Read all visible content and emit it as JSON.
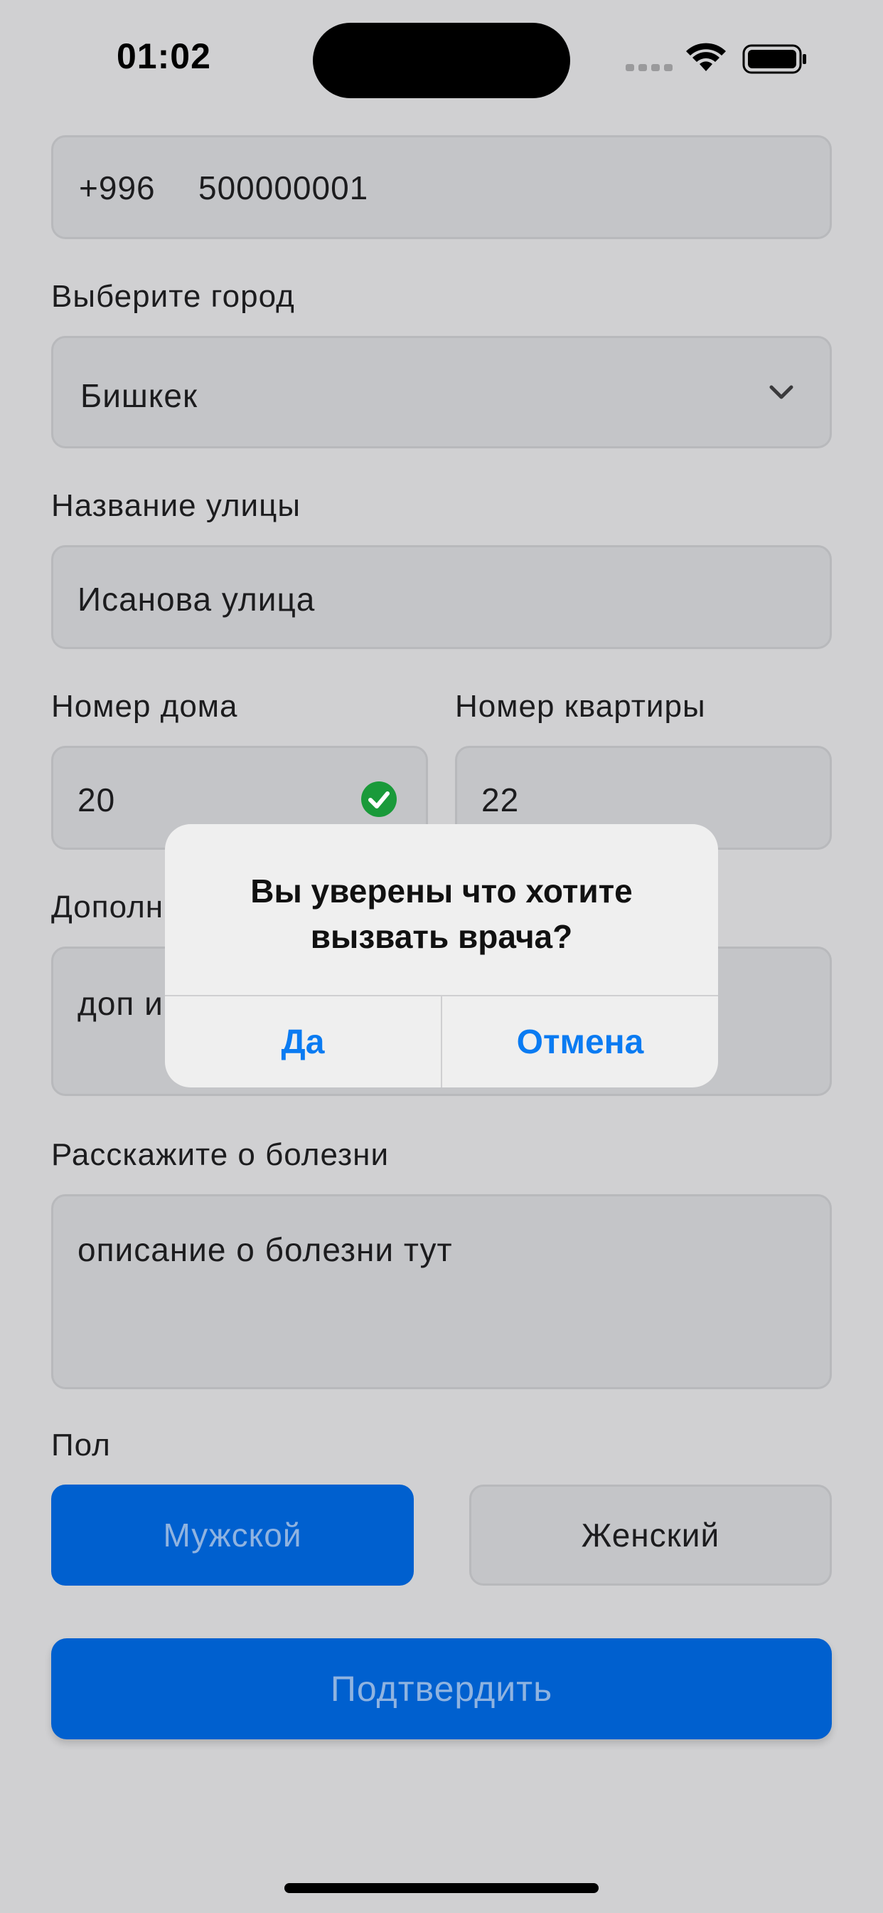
{
  "status_bar": {
    "time": "01:02"
  },
  "form": {
    "phone": {
      "code": "+996",
      "number": "500000001"
    },
    "city": {
      "label": "Выберите город",
      "value": "Бишкек"
    },
    "street": {
      "label": "Название улицы",
      "value": "Исанова улица"
    },
    "house": {
      "label": "Номер дома",
      "value": "20"
    },
    "apartment": {
      "label": "Номер квартиры",
      "value": "22"
    },
    "additional": {
      "label": "Дополн",
      "value": "доп и"
    },
    "illness": {
      "label": "Расскажите о болезни",
      "value": "описание о болезни тут"
    },
    "gender": {
      "label": "Пол",
      "male": "Мужской",
      "female": "Женский",
      "selected": "Мужской"
    },
    "confirm_label": "Подтвердить"
  },
  "alert": {
    "title": "Вы уверены что хотите\nвызвать врача?",
    "yes_label": "Да",
    "cancel_label": "Отмена"
  },
  "colors": {
    "accent": "#0060cf",
    "alert_button": "#0a7bf2",
    "valid_check": "#1a9a3a"
  }
}
